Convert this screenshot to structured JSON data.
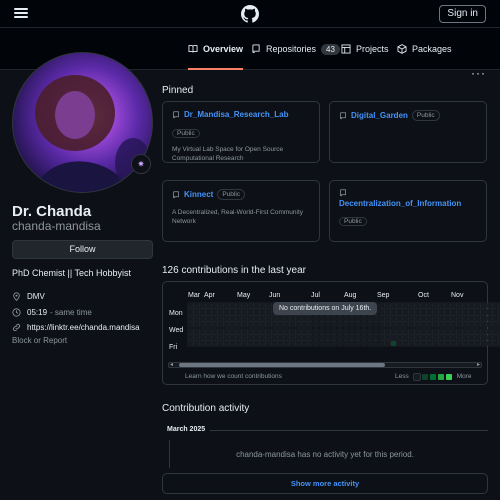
{
  "header": {
    "signin_label": "Sign in"
  },
  "tabs": [
    {
      "label": "Overview",
      "icon": "book-icon",
      "active": true
    },
    {
      "label": "Repositories",
      "icon": "repo-icon",
      "count": "43"
    },
    {
      "label": "Projects",
      "icon": "table-icon"
    },
    {
      "label": "Packages",
      "icon": "package-icon"
    }
  ],
  "profile": {
    "name": "Dr. Chanda",
    "login": "chanda-mandisa",
    "follow_label": "Follow",
    "bio": "PhD Chemist || Tech Hobbyist",
    "location": "DMV",
    "time": "05:19",
    "time_suffix": "- same time",
    "link": "https://linktr.ee/chanda.mandisa",
    "block_label": "Block or Report"
  },
  "pinned": {
    "title": "Pinned",
    "repos": [
      {
        "name": "Dr_Mandisa_Research_Lab",
        "visibility": "Public",
        "description": "My Virtual Lab Space for Open Source Computational Research"
      },
      {
        "name": "Digital_Garden",
        "visibility": "Public",
        "description": ""
      },
      {
        "name": "Kinnect",
        "visibility": "Public",
        "description": "A Decentralized, Real-World-First Community Network"
      },
      {
        "name": "Decentralization_of_Information",
        "visibility": "Public",
        "description": ""
      }
    ]
  },
  "contributions": {
    "title": "126 contributions in the last year",
    "months": [
      "Mar",
      "Apr",
      "May",
      "Jun",
      "Jul",
      "Aug",
      "Sep",
      "Oct",
      "Nov"
    ],
    "days": [
      "Mon",
      "Wed",
      "Fri"
    ],
    "tooltip": "No contributions on July 16th.",
    "learn_link": "Learn how we count contributions",
    "legend_less": "Less",
    "legend_more": "More",
    "legend_colors": [
      "#161b22",
      "#0e4429",
      "#006d32",
      "#26a641",
      "#39d353"
    ]
  },
  "activity": {
    "title": "Contribution activity",
    "month": "March 2025",
    "empty_text": "chanda-mandisa has no activity yet for this period.",
    "show_more": "Show more activity"
  }
}
